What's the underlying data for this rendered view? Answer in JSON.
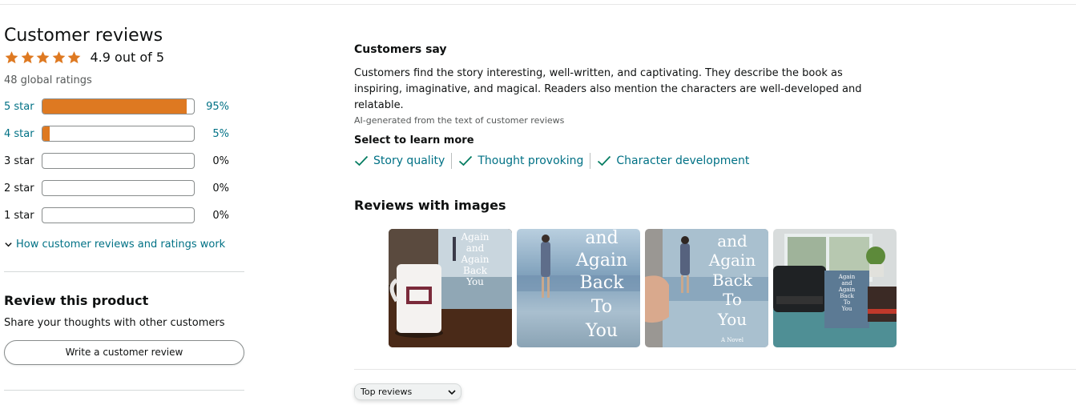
{
  "left": {
    "heading": "Customer reviews",
    "rating_text": "4.9 out of 5",
    "rating_value": 4.9,
    "global_ratings": "48 global ratings",
    "histogram": [
      {
        "label": "5 star",
        "percent": "95%",
        "fraction": 0.95
      },
      {
        "label": "4 star",
        "percent": "5%",
        "fraction": 0.05
      },
      {
        "label": "3 star",
        "percent": "0%",
        "fraction": 0
      },
      {
        "label": "2 star",
        "percent": "0%",
        "fraction": 0
      },
      {
        "label": "1 star",
        "percent": "0%",
        "fraction": 0
      }
    ],
    "how_link": "How customer reviews and ratings work",
    "review_heading": "Review this product",
    "share_text": "Share your thoughts with other customers",
    "write_button": "Write a customer review"
  },
  "right": {
    "customers_say_heading": "Customers say",
    "summary": "Customers find the story interesting, well-written, and captivating. They describe the book as inspiring, imaginative, and magical. Readers also mention the characters are well-developed and relatable.",
    "ai_note": "AI-generated from the text of customer reviews",
    "select_heading": "Select to learn more",
    "aspects": [
      "Story quality",
      "Thought provoking",
      "Character development"
    ],
    "images_heading": "Reviews with images",
    "sort_label": "Top reviews"
  },
  "colors": {
    "star": "#de7921",
    "link": "#007185",
    "bar_fill": "#de7921",
    "text": "#0f1111",
    "muted": "#565959"
  },
  "book_cover_words": [
    "Again",
    "and",
    "Again",
    "Back",
    "To",
    "You",
    "A Novel"
  ],
  "icons": [
    "star-icon",
    "chevron-down-icon",
    "check-icon"
  ]
}
